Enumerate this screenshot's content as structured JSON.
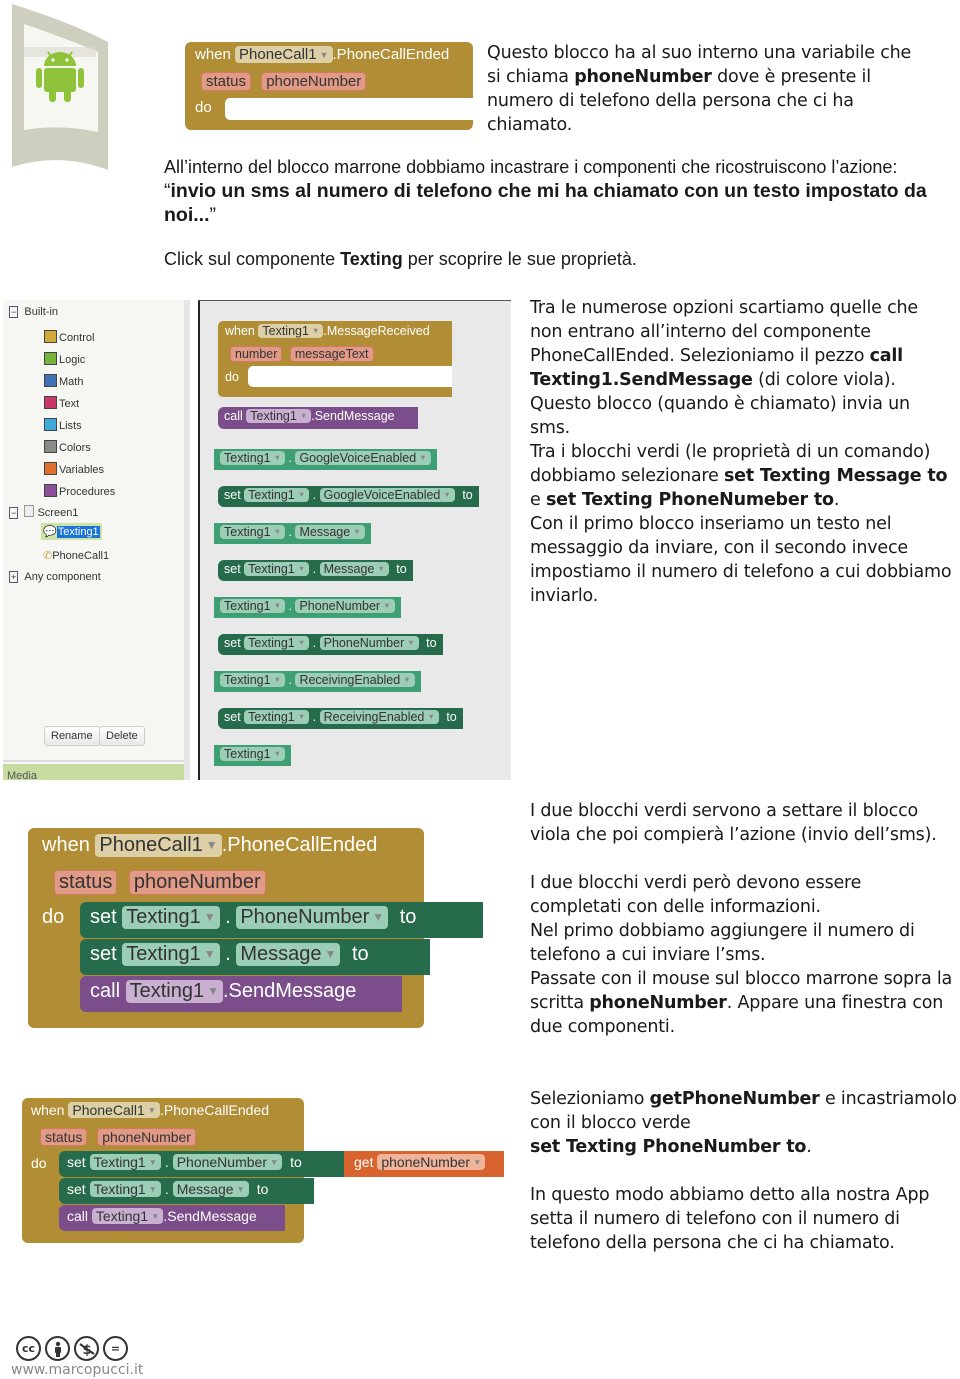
{
  "header": {
    "logo_icon": "android-icon",
    "intro_text_parts": [
      "Questo blocco ha al suo interno una variabile che si chiama ",
      "phoneNumber",
      " dove è presente il numero di telefono della persona che ci ha chiamato."
    ]
  },
  "block1": {
    "when": "when",
    "component": "PhoneCall1",
    "event": ".PhoneCallEnded",
    "params": [
      "status",
      "phoneNumber"
    ],
    "do": "do"
  },
  "section2": {
    "line1": "All’interno del blocco marrone dobbiamo incastrare i componenti che ricostruiscono l’azione:",
    "quote_open": "“",
    "quote_bold": "invio un sms al numero di telefono che mi ha chiamato con un testo impostato da noi...",
    "quote_close": "”",
    "click_parts": [
      "Click sul componente ",
      "Texting",
      " per scoprire le sue proprietà."
    ]
  },
  "palette": {
    "builtin_label": "Built-in",
    "items": [
      {
        "label": "Control",
        "color": "#d3a83b"
      },
      {
        "label": "Logic",
        "color": "#78b43c"
      },
      {
        "label": "Math",
        "color": "#3f72b5"
      },
      {
        "label": "Text",
        "color": "#c8366a"
      },
      {
        "label": "Lists",
        "color": "#40a8da"
      },
      {
        "label": "Colors",
        "color": "#8a8a8a"
      },
      {
        "label": "Variables",
        "color": "#e0702e"
      },
      {
        "label": "Procedures",
        "color": "#8a4f98"
      }
    ],
    "screen_label": "Screen1",
    "components": [
      "Texting1",
      "PhoneCall1"
    ],
    "selected": "Texting1",
    "any_component": "Any component",
    "rename_button": "Rename",
    "delete_button": "Delete",
    "media_label": "Media"
  },
  "workspace": {
    "event_block": {
      "when": "when",
      "component": "Texting1",
      "event": ".MessageReceived",
      "params": [
        "number",
        "messageText"
      ],
      "do": "do"
    },
    "call_block": {
      "call": "call",
      "component": "Texting1",
      "method": ".SendMessage"
    },
    "property_blocks": [
      {
        "type": "get",
        "component": "Texting1",
        "property": "GoogleVoiceEnabled"
      },
      {
        "type": "set",
        "set": "set",
        "component": "Texting1",
        "property": "GoogleVoiceEnabled",
        "to": "to"
      },
      {
        "type": "get",
        "component": "Texting1",
        "property": "Message"
      },
      {
        "type": "set",
        "set": "set",
        "component": "Texting1",
        "property": "Message",
        "to": "to"
      },
      {
        "type": "get",
        "component": "Texting1",
        "property": "PhoneNumber"
      },
      {
        "type": "set",
        "set": "set",
        "component": "Texting1",
        "property": "PhoneNumber",
        "to": "to"
      },
      {
        "type": "get",
        "component": "Texting1",
        "property": "ReceivingEnabled"
      },
      {
        "type": "set",
        "set": "set",
        "component": "Texting1",
        "property": "ReceivingEnabled",
        "to": "to"
      },
      {
        "type": "comp",
        "component": "Texting1"
      }
    ]
  },
  "right_text1": [
    {
      "t": "Tra le numerose opzioni scartiamo quelle che non entrano all’interno del componente PhoneCallEnded. Selezioniamo il pezzo "
    },
    {
      "b": "call Texting1.SendMessage"
    },
    {
      "t": " (di colore viola). Questo blocco (quando è chiamato) invia un sms."
    },
    {
      "br": true
    },
    {
      "t": "Tra i blocchi verdi (le proprietà di un comando) dobbiamo selezionare "
    },
    {
      "b": "set Texting Message to"
    },
    {
      "t": " e "
    },
    {
      "b": "set Texting PhoneNumeber to"
    },
    {
      "t": "."
    },
    {
      "br": true
    },
    {
      "t": "Con il primo blocco inseriamo un testo nel messaggio da inviare, con il secondo invece impostiamo il numero di telefono a cui dobbiamo inviarlo."
    }
  ],
  "block2": {
    "when": "when",
    "component": "PhoneCall1",
    "event": ".PhoneCallEnded",
    "params": [
      "status",
      "phoneNumber"
    ],
    "do": "do",
    "set1": {
      "set": "set",
      "component": "Texting1",
      "dot": ".",
      "property": "PhoneNumber",
      "to": "to"
    },
    "set2": {
      "set": "set",
      "component": "Texting1",
      "dot": ".",
      "property": "Message",
      "to": "to"
    },
    "call": {
      "call": "call",
      "component": "Texting1",
      "method": ".SendMessage"
    }
  },
  "right_text2": {
    "p1": "I due blocchi verdi servono a settare il blocco viola che poi compierà l’azione (invio dell’sms).",
    "p2_parts": [
      "I due blocchi verdi però devono essere completati con delle informazioni.",
      "Nel primo dobbiamo aggiungere il numero di telefono a cui inviare l’sms.",
      "Passate con il mouse sul blocco marrone sopra la scritta ",
      "phoneNumber",
      ". Appare una finestra con due componenti."
    ]
  },
  "block3": {
    "when": "when",
    "component": "PhoneCall1",
    "event": ".PhoneCallEnded",
    "params": [
      "status",
      "phoneNumber"
    ],
    "do": "do",
    "set1": {
      "set": "set",
      "component": "Texting1",
      "dot": ".",
      "property": "PhoneNumber",
      "to": "to"
    },
    "get": {
      "get": "get",
      "variable": "phoneNumber"
    },
    "set2": {
      "set": "set",
      "component": "Texting1",
      "dot": ".",
      "property": "Message",
      "to": "to"
    },
    "call": {
      "call": "call",
      "component": "Texting1",
      "method": ".SendMessage"
    }
  },
  "right_text3": {
    "p1_parts": [
      "Selezioniamo ",
      "getPhoneNumber",
      " e incastriamolo con il blocco verde",
      "set Texting PhoneNumber to",
      "."
    ],
    "p2": "In questo modo abbiamo detto alla nostra App setta il numero di telefono con il numero di telefono della persona che ci ha chiamato."
  },
  "footer": {
    "license_icons": [
      "cc-icon",
      "by-icon",
      "nc-icon",
      "nd-icon"
    ],
    "cc_label": "cc",
    "nd_label": "=",
    "website": "www.marcopucci.it"
  }
}
